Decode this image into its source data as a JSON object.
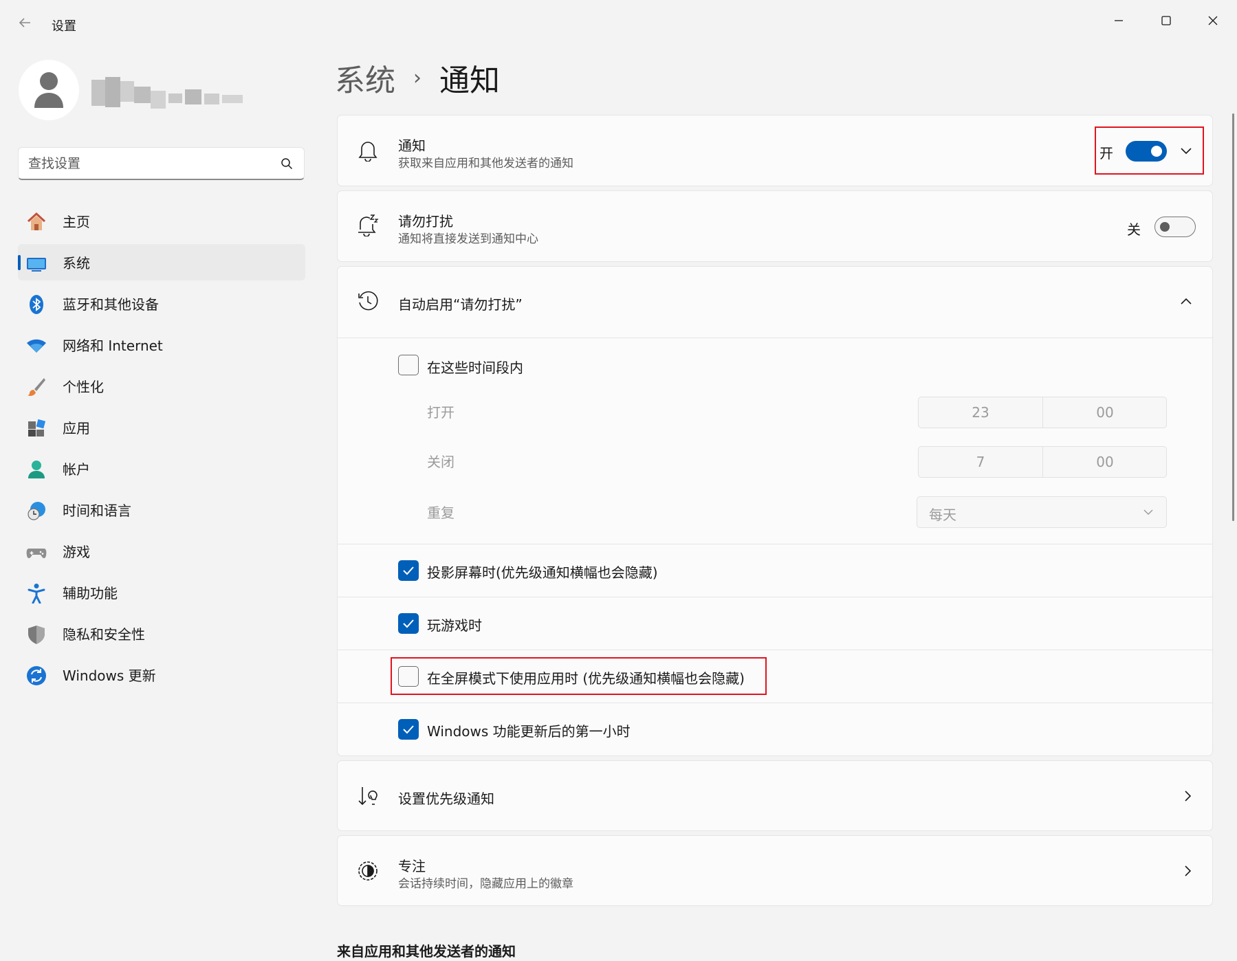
{
  "window": {
    "title": "设置",
    "back_icon": "back-arrow-icon",
    "controls": [
      "minimize-icon",
      "maximize-icon",
      "close-icon"
    ]
  },
  "profile": {
    "name": "",
    "avatar_icon": "person-icon"
  },
  "search": {
    "placeholder": "查找设置",
    "value": "",
    "icon": "search-icon"
  },
  "sidebar": {
    "items": [
      {
        "label": "主页",
        "icon": "home-icon",
        "active": false
      },
      {
        "label": "系统",
        "icon": "system-display-icon",
        "active": true
      },
      {
        "label": "蓝牙和其他设备",
        "icon": "bluetooth-icon",
        "active": false
      },
      {
        "label": "网络和 Internet",
        "icon": "wifi-icon",
        "active": false
      },
      {
        "label": "个性化",
        "icon": "brush-icon",
        "active": false
      },
      {
        "label": "应用",
        "icon": "apps-icon",
        "active": false
      },
      {
        "label": "帐户",
        "icon": "account-icon",
        "active": false
      },
      {
        "label": "时间和语言",
        "icon": "globe-clock-icon",
        "active": false
      },
      {
        "label": "游戏",
        "icon": "gamepad-icon",
        "active": false
      },
      {
        "label": "辅助功能",
        "icon": "accessibility-icon",
        "active": false
      },
      {
        "label": "隐私和安全性",
        "icon": "shield-icon",
        "active": false
      },
      {
        "label": "Windows 更新",
        "icon": "update-icon",
        "active": false
      }
    ]
  },
  "breadcrumb": {
    "parent": "系统",
    "separator": "›",
    "current": "通知"
  },
  "notifications": {
    "title": "通知",
    "subtitle": "获取来自应用和其他发送者的通知",
    "toggle_label": "开",
    "toggle_on": true,
    "icon": "bell-icon"
  },
  "dnd": {
    "title": "请勿打扰",
    "subtitle": "通知将直接发送到通知中心",
    "toggle_label": "关",
    "toggle_on": false,
    "icon": "bell-snooze-icon"
  },
  "auto_dnd": {
    "title": "自动启用“请勿打扰”",
    "icon": "clock-rotate-icon",
    "expanded": true,
    "during_times": {
      "label": "在这些时间段内",
      "checked": false
    },
    "turn_on": {
      "label": "打开",
      "hour": "23",
      "minute": "00"
    },
    "turn_off": {
      "label": "关闭",
      "hour": "7",
      "minute": "00"
    },
    "repeat": {
      "label": "重复",
      "value": "每天"
    },
    "options": [
      {
        "label": "投影屏幕时(优先级通知横幅也会隐藏)",
        "checked": true
      },
      {
        "label": "玩游戏时",
        "checked": true
      },
      {
        "label": "在全屏模式下使用应用时 (优先级通知横幅也会隐藏)",
        "checked": false
      },
      {
        "label": "Windows 功能更新后的第一小时",
        "checked": true
      }
    ]
  },
  "priority": {
    "title": "设置优先级通知",
    "icon": "priority-sort-icon"
  },
  "focus": {
    "title": "专注",
    "subtitle": "会话持续时间，隐藏应用上的徽章",
    "icon": "focus-icon"
  },
  "section_header": "来自应用和其他发送者的通知",
  "colors": {
    "accent": "#005fb8",
    "highlight": "#e0141e",
    "background": "#f3f3f3",
    "card": "#fbfbfb"
  }
}
